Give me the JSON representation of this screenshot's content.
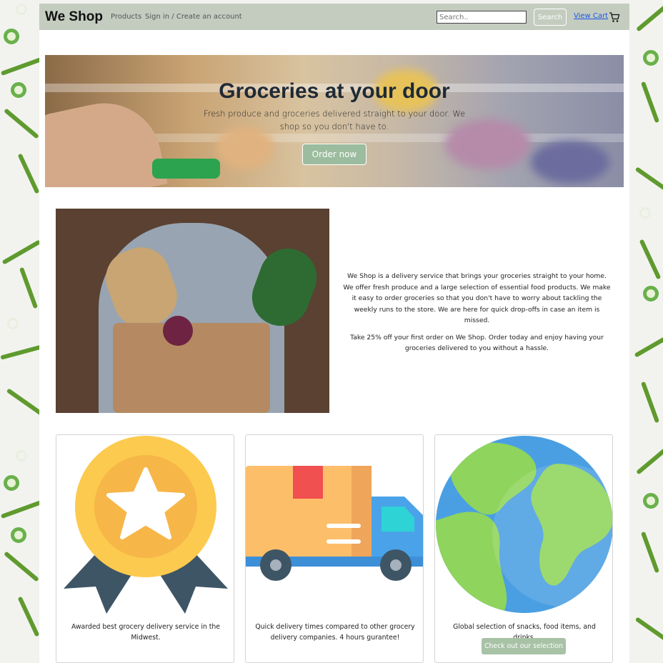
{
  "navbar": {
    "brand": "We Shop",
    "links": [
      "Products",
      "Sign in / Create an account"
    ],
    "search_placeholder": "Search..",
    "search_button": "Search",
    "cart_link": "View Cart",
    "cart_icon": "cart-icon",
    "bg_color": "#c4ccc0"
  },
  "hero": {
    "title": "Groceries at your door",
    "subtitle": "Fresh produce and groceries delivered straight to your door. We shop so you don't have to.",
    "button": "Order now",
    "button_color": "#9bbc9e"
  },
  "about": {
    "paragraph1": "We Shop is a delivery service that brings your groceries straight to your home. We offer fresh produce and a large selection of essential food products. We make it easy to order groceries so that you don't have to worry about tackling the weekly runs to the store. We are here for quick drop-offs in case an item is missed.",
    "paragraph2": "Take 25% off your first order on We Shop. Order today and enjoy having your groceries delivered to you without a hassle."
  },
  "cards": [
    {
      "icon": "award-medal-icon",
      "text": "Awarded best grocery delivery service in the Midwest."
    },
    {
      "icon": "delivery-truck-icon",
      "text": "Quick delivery times compared to other grocery delivery companies. 4 hours gurantee!"
    },
    {
      "icon": "globe-icon",
      "text": "Global selection of snacks, food items, and drinks.",
      "button": "Check out our selection"
    }
  ]
}
